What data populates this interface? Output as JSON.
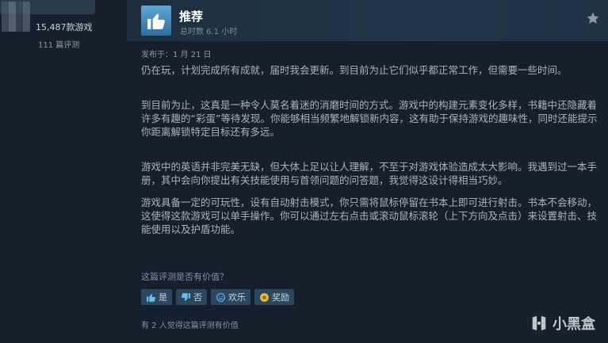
{
  "sidebar": {
    "games_count": "15,487款游戏",
    "reviews_count": "111 篇评测"
  },
  "review": {
    "title": "推荐",
    "hours": "总时数 6.1 小时",
    "posted": "发布于：1 月 21 日",
    "paragraphs": [
      "仍在玩，计划完成所有成就，届时我会更新。到目前为止它们似乎都正常工作，但需要一些时间。",
      "到目前为止，这真是一种令人莫名着迷的消磨时间的方式。游戏中的构建元素变化多样，书籍中还隐藏着许多有趣的“彩蛋”等待发现。你能够相当频繁地解锁新内容，这有助于保持游戏的趣味性，同时还能提示你距离解锁特定目标还有多远。",
      "游戏中的英语并非完美无缺，但大体上足以让人理解，不至于对游戏体验造成太大影响。我遇到过一本手册，其中会向你提出有关技能使用与首领问题的问答题，我觉得这设计得相当巧妙。",
      "游戏具备一定的可玩性，设有自动射击模式，你只需将鼠标停留在书本上即可进行射击。书本不会移动，这使得这款游戏可以单手操作。你可以通过左右点击或滚动鼠标滚轮（上下方向及点击）来设置射击、技能使用以及护盾功能。"
    ]
  },
  "voting": {
    "question": "这篇评测是否有价值？",
    "yes": "是",
    "no": "否",
    "funny": "欢乐",
    "award": "奖励",
    "helpful_count": "有 2 人觉得这篇评测有价值"
  },
  "watermark": {
    "text": "小黑盒"
  },
  "colors": {
    "background": "#1b2838",
    "button": "#2a475e",
    "thumb": "#5fa8d6"
  }
}
